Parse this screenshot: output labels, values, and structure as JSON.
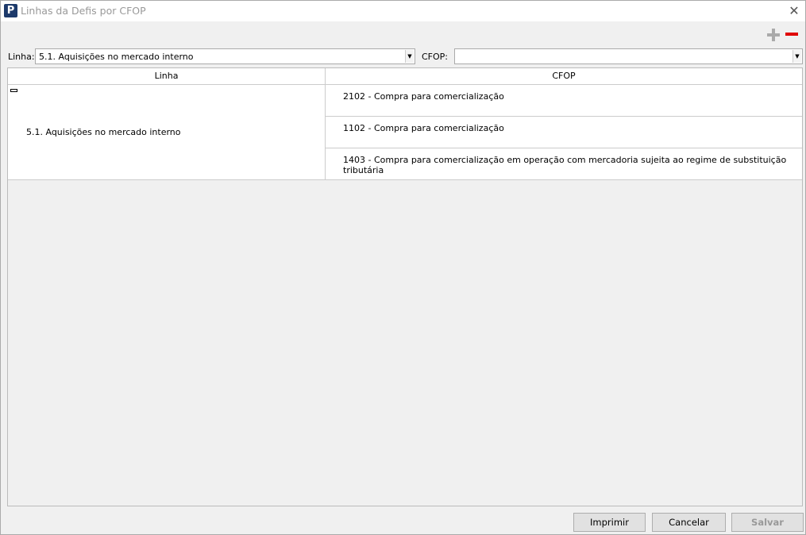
{
  "window": {
    "title": "Linhas da Defis por CFOP",
    "logo": "P"
  },
  "toolbar": {
    "add_icon": "plus-icon",
    "remove_icon": "minus-icon",
    "remove_color": "#e00000"
  },
  "filters": {
    "linha_label": "Linha:",
    "linha_value": "5.1. Aquisições no mercado interno",
    "cfop_label": "CFOP:",
    "cfop_value": ""
  },
  "grid": {
    "columns": [
      "Linha",
      "CFOP"
    ],
    "group": {
      "linha": "5.1. Aquisições no mercado interno",
      "cfops": [
        "2102 - Compra para comercialização",
        "1102 - Compra para comercialização",
        "1403 - Compra para comercialização em operação com mercadoria sujeita ao regime de substituição tributária"
      ]
    }
  },
  "buttons": {
    "print": "Imprimir",
    "cancel": "Cancelar",
    "save": "Salvar"
  }
}
